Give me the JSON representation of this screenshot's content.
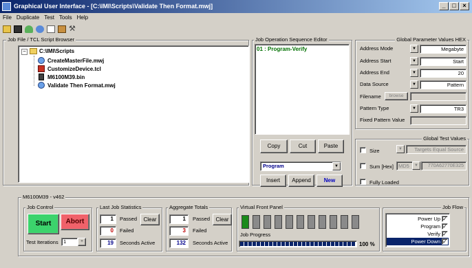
{
  "window": {
    "title": "Graphical User Interface - [C:\\IMI\\Scripts\\Validate Then Format.mwj]",
    "min": "_",
    "max": "□",
    "close": "×"
  },
  "menu": [
    "File",
    "Duplicate",
    "Test",
    "Tools",
    "Help"
  ],
  "toolbar_icons": [
    "open-folder-icon",
    "save-icon",
    "person-icon",
    "refresh-icon",
    "document-icon",
    "settings-gear-icon",
    "tools-icon"
  ],
  "browser": {
    "title": "Job File / TCL Script Browser",
    "expander": "−",
    "root": "C:\\IMI\\Scripts",
    "items": [
      "CreateMasterFile.mwj",
      "CustomizeDevice.tcl",
      "M6100M39.bin",
      "Validate Then Format.mwj"
    ]
  },
  "sequence": {
    "title": "Job Operation Sequence Editor",
    "items": [
      "01 : Program-Verify"
    ],
    "copy": "Copy",
    "cut": "Cut",
    "paste": "Paste",
    "operation": "Program",
    "insert": "Insert",
    "append": "Append",
    "new": "New"
  },
  "params": {
    "title": "Global Parameter Values HEX",
    "address_mode_label": "Address Mode",
    "address_mode": "Megabyte",
    "address_start_label": "Address Start",
    "address_start": "Start",
    "address_end_label": "Address End",
    "address_end": "20",
    "data_source_label": "Data Source",
    "data_source": "Pattern",
    "filename_label": "Filename",
    "browse": "browse",
    "filename": "",
    "pattern_type_label": "Pattern Type",
    "pattern_type": "TR3",
    "fixed_pattern_label": "Fixed Pattern Value",
    "fixed_pattern": ""
  },
  "test_values": {
    "title": "Global Test Values",
    "size_label": "Size",
    "size_value": "Targets Equal Source",
    "sum_label": "Sum [Hex]",
    "sum_algo": "MD5",
    "sum_value": "770A62770E325",
    "fully_loaded_label": "Fully Loaded"
  },
  "device": {
    "title": "M6100M39 - v462",
    "job_control": {
      "title": "Job Control",
      "start": "Start",
      "abort": "Abort",
      "iterations_label": "Test Iterations",
      "iterations": "1"
    },
    "last_job": {
      "title": "Last Job Statistics",
      "passed": "1",
      "passed_label": "Passed",
      "failed": "0",
      "failed_label": "Failed",
      "seconds": "19",
      "seconds_label": "Seconds Active",
      "clear": "Clear"
    },
    "aggregate": {
      "title": "Aggregate Totals",
      "passed": "1",
      "passed_label": "Passed",
      "failed": "3",
      "failed_label": "Failed",
      "seconds": "132",
      "seconds_label": "Seconds Active",
      "clear": "Clear"
    },
    "front_panel": {
      "title": "Virtual Front Panel",
      "leds_on": [
        true,
        false,
        false,
        false,
        false,
        false,
        false,
        false,
        false,
        false,
        false
      ]
    },
    "progress": {
      "title": "Job Progress",
      "percent": 100,
      "percent_label": "100 %"
    },
    "job_flow": {
      "title": "Job Flow",
      "steps": [
        "Power Up",
        "Program",
        "Verify",
        "Power Down"
      ],
      "selected": 3
    }
  },
  "colors": {
    "title_blue": "#0a246a",
    "start_green": "#3cd36c",
    "abort_red": "#f0626a",
    "led_green": "#1a8a1a",
    "progress_blue": "#0a246a",
    "select_blue": "#0a246a"
  }
}
